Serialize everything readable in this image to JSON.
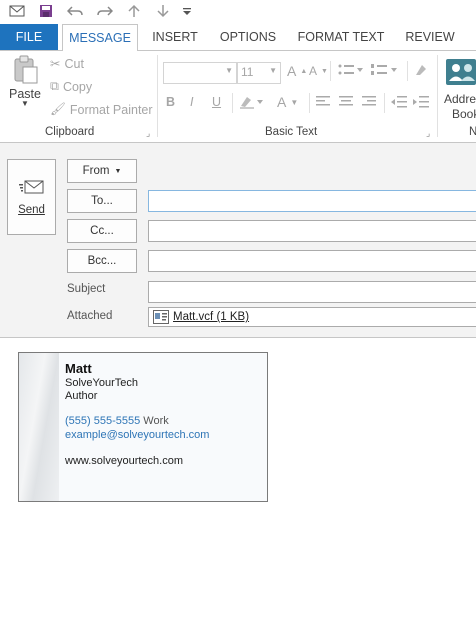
{
  "qat": {
    "icons": [
      "mail-icon",
      "save-icon",
      "undo-icon",
      "redo-icon",
      "up-icon",
      "down-icon",
      "customize-icon"
    ]
  },
  "tabs": [
    "FILE",
    "MESSAGE",
    "INSERT",
    "OPTIONS",
    "FORMAT TEXT",
    "REVIEW"
  ],
  "ribbon": {
    "clipboard": {
      "paste": "Paste",
      "cut": "Cut",
      "copy": "Copy",
      "format_painter": "Format Painter",
      "group_label": "Clipboard"
    },
    "basic_text": {
      "font_size": "11",
      "bold": "B",
      "italic": "I",
      "underline": "U",
      "font_color": "A",
      "grow_font": "A",
      "shrink_font": "A",
      "group_label": "Basic Text"
    },
    "names": {
      "address_book_line1": "Addre",
      "address_book_line2": "Book",
      "group_label": "N"
    }
  },
  "compose": {
    "send": "Send",
    "from": "From",
    "to": "To...",
    "cc": "Cc...",
    "bcc": "Bcc...",
    "subject": "Subject",
    "attached": "Attached",
    "attachment": "Matt.vcf (1 KB)",
    "to_value": "",
    "cc_value": "",
    "bcc_value": "",
    "subject_value": ""
  },
  "card": {
    "name": "Matt",
    "company": "SolveYourTech",
    "title": "Author",
    "phone": "(555) 555-5555",
    "phone_type": "Work",
    "email": "example@solveyourtech.com",
    "website": "www.solveyourtech.com"
  },
  "colors": {
    "file_tab": "#1e73be",
    "active_tab_text": "#2b6fb6",
    "link_blue": "#2e75b6"
  }
}
